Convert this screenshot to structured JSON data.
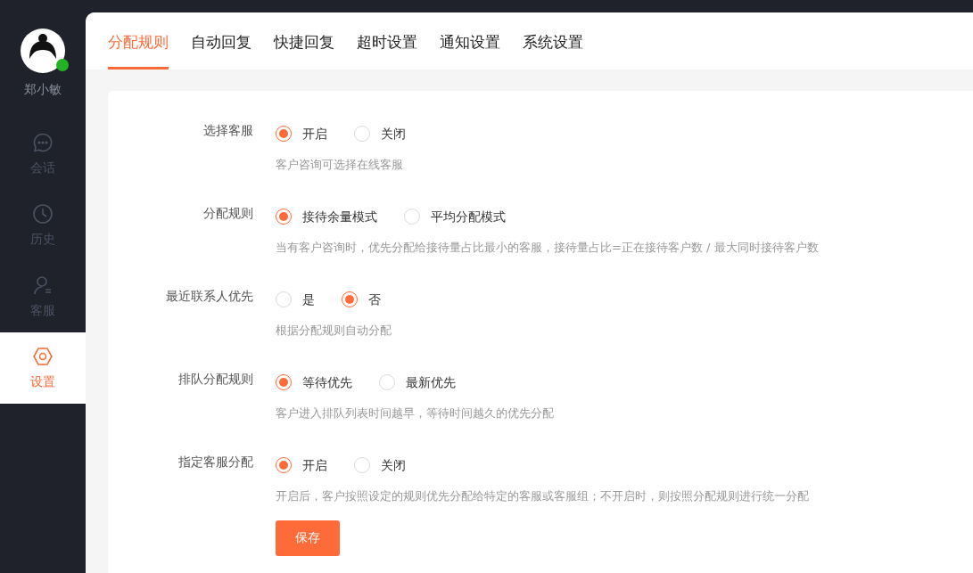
{
  "sidebar": {
    "user": {
      "name": "郑小敏",
      "online": true
    },
    "items": [
      {
        "kind": "chat",
        "label": "会话",
        "selected": false
      },
      {
        "kind": "history",
        "label": "历史",
        "selected": false
      },
      {
        "kind": "agent",
        "label": "客服",
        "selected": false
      },
      {
        "kind": "settings",
        "label": "设置",
        "selected": true
      }
    ]
  },
  "tabs": [
    {
      "label": "分配规则",
      "selected": true
    },
    {
      "label": "自动回复",
      "selected": false
    },
    {
      "label": "快捷回复",
      "selected": false
    },
    {
      "label": "超时设置",
      "selected": false
    },
    {
      "label": "通知设置",
      "selected": false
    },
    {
      "label": "系统设置",
      "selected": false
    }
  ],
  "form": {
    "rows": [
      {
        "label": "选择客服",
        "options": [
          {
            "label": "开启",
            "selected": true
          },
          {
            "label": "关闭",
            "selected": false
          }
        ],
        "description": "客户咨询可选择在线客服"
      },
      {
        "label": "分配规则",
        "options": [
          {
            "label": "接待余量模式",
            "selected": true
          },
          {
            "label": "平均分配模式",
            "selected": false
          }
        ],
        "description": "当有客户咨询时，优先分配给接待量占比最小的客服，接待量占比=正在接待客户数 / 最大同时接待客户数"
      },
      {
        "label": "最近联系人优先",
        "options": [
          {
            "label": "是",
            "selected": false
          },
          {
            "label": "否",
            "selected": true
          }
        ],
        "description": "根据分配规则自动分配"
      },
      {
        "label": "排队分配规则",
        "options": [
          {
            "label": "等待优先",
            "selected": true
          },
          {
            "label": "最新优先",
            "selected": false
          }
        ],
        "description": "客户进入排队列表时间越早，等待时间越久的优先分配"
      },
      {
        "label": "指定客服分配",
        "options": [
          {
            "label": "开启",
            "selected": true
          },
          {
            "label": "关闭",
            "selected": false
          }
        ],
        "description": "开启后，客户按照设定的规则优先分配给特定的客服或客服组；不开启时，则按照分配规则进行统一分配"
      }
    ],
    "save_button": "保存"
  }
}
